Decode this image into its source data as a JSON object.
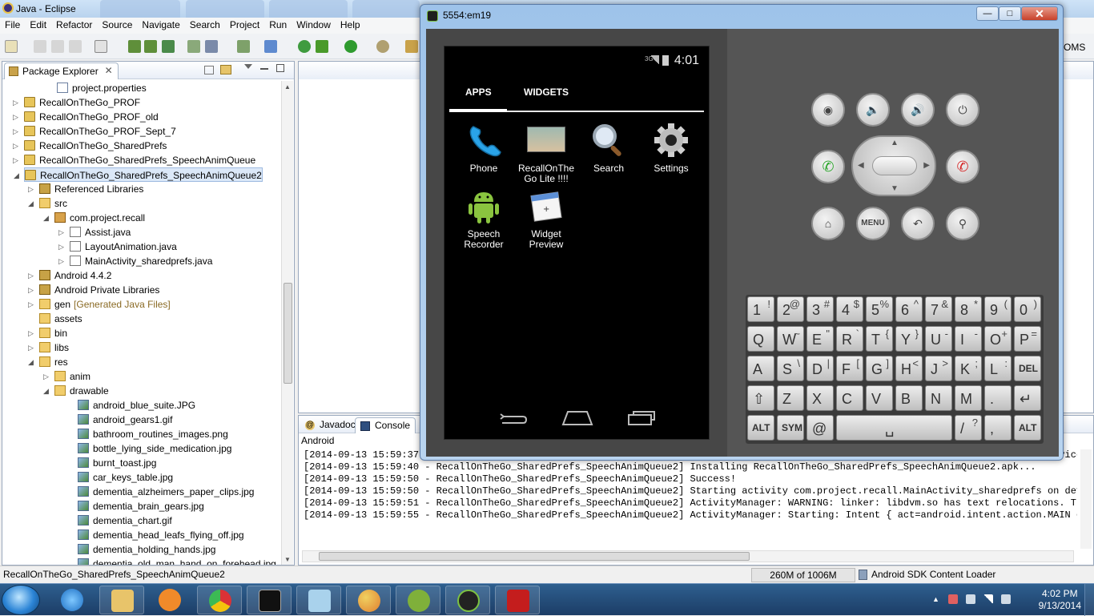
{
  "eclipse": {
    "title": "Java - Eclipse",
    "menu": [
      "File",
      "Edit",
      "Refactor",
      "Source",
      "Navigate",
      "Search",
      "Project",
      "Run",
      "Window",
      "Help"
    ],
    "oms_label": "OMS"
  },
  "package_explorer": {
    "tab_label": "Package Explorer",
    "close_glyph": "✕",
    "tree": [
      {
        "label": "project.properties",
        "icon": "file-icon",
        "expand": ""
      },
      {
        "label": "RecallOnTheGo_PROF",
        "icon": "project-icon",
        "expand": "▷"
      },
      {
        "label": "RecallOnTheGo_PROF_old",
        "icon": "project-icon",
        "expand": "▷"
      },
      {
        "label": "RecallOnTheGo_PROF_Sept_7",
        "icon": "project-icon",
        "expand": "▷"
      },
      {
        "label": "RecallOnTheGo_SharedPrefs",
        "icon": "project-icon",
        "expand": "▷"
      },
      {
        "label": "RecallOnTheGo_SharedPrefs_SpeechAnimQueue",
        "icon": "project-icon",
        "expand": "▷"
      },
      {
        "label": "RecallOnTheGo_SharedPrefs_SpeechAnimQueue2",
        "icon": "project-icon",
        "expand": "◢"
      },
      {
        "label": "Referenced Libraries",
        "icon": "library-icon",
        "expand": "▷"
      },
      {
        "label": "src",
        "icon": "source-folder-icon",
        "expand": "◢"
      },
      {
        "label": "com.project.recall",
        "icon": "package-icon",
        "expand": "◢"
      },
      {
        "label": "Assist.java",
        "icon": "java-file-icon",
        "expand": "▷"
      },
      {
        "label": "LayoutAnimation.java",
        "icon": "java-file-icon",
        "expand": "▷"
      },
      {
        "label": "MainActivity_sharedprefs.java",
        "icon": "java-file-icon",
        "expand": "▷"
      },
      {
        "label": "Android 4.4.2",
        "icon": "library-icon",
        "expand": "▷"
      },
      {
        "label": "Android Private Libraries",
        "icon": "library-icon",
        "expand": "▷"
      },
      {
        "label": "gen",
        "icon": "folder-icon",
        "expand": "▷",
        "suffix": "[Generated Java Files]"
      },
      {
        "label": "assets",
        "icon": "folder-icon",
        "expand": ""
      },
      {
        "label": "bin",
        "icon": "folder-icon",
        "expand": "▷"
      },
      {
        "label": "libs",
        "icon": "folder-icon",
        "expand": "▷"
      },
      {
        "label": "res",
        "icon": "folder-icon",
        "expand": "◢"
      },
      {
        "label": "anim",
        "icon": "folder-icon",
        "expand": "▷"
      },
      {
        "label": "drawable",
        "icon": "folder-icon",
        "expand": "◢"
      },
      {
        "label": "android_blue_suite.JPG",
        "icon": "image-file-icon",
        "expand": ""
      },
      {
        "label": "android_gears1.gif",
        "icon": "image-file-icon",
        "expand": ""
      },
      {
        "label": "bathroom_routines_images.png",
        "icon": "image-file-icon",
        "expand": ""
      },
      {
        "label": "bottle_lying_side_medication.jpg",
        "icon": "image-file-icon",
        "expand": ""
      },
      {
        "label": "burnt_toast.jpg",
        "icon": "image-file-icon",
        "expand": ""
      },
      {
        "label": "car_keys_table.jpg",
        "icon": "image-file-icon",
        "expand": ""
      },
      {
        "label": "dementia_alzheimers_paper_clips.jpg",
        "icon": "image-file-icon",
        "expand": ""
      },
      {
        "label": "dementia_brain_gears.jpg",
        "icon": "image-file-icon",
        "expand": ""
      },
      {
        "label": "dementia_chart.gif",
        "icon": "image-file-icon",
        "expand": ""
      },
      {
        "label": "dementia_head_leafs_flying_off.jpg",
        "icon": "image-file-icon",
        "expand": ""
      },
      {
        "label": "dementia_holding_hands.jpg",
        "icon": "image-file-icon",
        "expand": ""
      },
      {
        "label": "dementia_old_man_hand_on_forehead.jpg",
        "icon": "image-file-icon",
        "expand": ""
      }
    ]
  },
  "console": {
    "tabs": [
      "Javadoc",
      "Console"
    ],
    "subtitle": "Android",
    "lines": [
      "[2014-09-13 15:59:37 - RecallOnTheGo_SharedPrefs_SpeechAnimQueue2] Uploading RecallOnTheGo_SharedPrefs_SpeechAnimQueue2.apk onto device 'em",
      "[2014-09-13 15:59:40 - RecallOnTheGo_SharedPrefs_SpeechAnimQueue2] Installing RecallOnTheGo_SharedPrefs_SpeechAnimQueue2.apk...",
      "[2014-09-13 15:59:50 - RecallOnTheGo_SharedPrefs_SpeechAnimQueue2] Success!",
      "[2014-09-13 15:59:50 - RecallOnTheGo_SharedPrefs_SpeechAnimQueue2] Starting activity com.project.recall.MainActivity_sharedprefs on device",
      "[2014-09-13 15:59:51 - RecallOnTheGo_SharedPrefs_SpeechAnimQueue2] ActivityManager: WARNING: linker: libdvm.so has text relocations. This i",
      "[2014-09-13 15:59:55 - RecallOnTheGo_SharedPrefs_SpeechAnimQueue2] ActivityManager: Starting: Intent { act=android.intent.action.MAIN cat=["
    ]
  },
  "status": {
    "selected": "RecallOnTheGo_SharedPrefs_SpeechAnimQueue2",
    "memory": "260M of 1006M",
    "loader": "Android SDK Content Loader"
  },
  "emulator": {
    "title": "5554:em19",
    "minimize": "—",
    "maximize": "□",
    "close": "✕",
    "phone": {
      "time": "4:01",
      "signal": "3G",
      "tabs": [
        "APPS",
        "WIDGETS"
      ],
      "apps": [
        {
          "label": "Phone",
          "icon": "phone-icon"
        },
        {
          "label": "RecallOnThe Go Lite !!!!",
          "icon": "recall-app-icon"
        },
        {
          "label": "Search",
          "icon": "search-icon"
        },
        {
          "label": "Settings",
          "icon": "settings-gear-icon"
        },
        {
          "label": "Speech Recorder",
          "icon": "android-robot-icon"
        },
        {
          "label": "Widget Preview",
          "icon": "widget-preview-icon"
        }
      ]
    },
    "hw_buttons": {
      "menu": "MENU"
    },
    "keyboard": {
      "row1": [
        [
          "1",
          "!"
        ],
        [
          "2",
          "@"
        ],
        [
          "3",
          "#"
        ],
        [
          "4",
          "$"
        ],
        [
          "5",
          "%"
        ],
        [
          "6",
          "^"
        ],
        [
          "7",
          "&"
        ],
        [
          "8",
          "*"
        ],
        [
          "9",
          "("
        ],
        [
          "0",
          ")"
        ]
      ],
      "row2": [
        [
          "Q",
          ""
        ],
        [
          "W",
          "~"
        ],
        [
          "E",
          "\""
        ],
        [
          "R",
          "`"
        ],
        [
          "T",
          "{"
        ],
        [
          "Y",
          "}"
        ],
        [
          "U",
          "-"
        ],
        [
          "I",
          "-"
        ],
        [
          "O",
          "+"
        ],
        [
          "P",
          "="
        ]
      ],
      "row3": [
        [
          "A",
          ""
        ],
        [
          "S",
          "\\"
        ],
        [
          "D",
          "|"
        ],
        [
          "F",
          "["
        ],
        [
          "G",
          "]"
        ],
        [
          "H",
          "<"
        ],
        [
          "J",
          ">"
        ],
        [
          "K",
          ";"
        ],
        [
          "L",
          ":"
        ],
        [
          "DEL",
          ""
        ]
      ],
      "row4": [
        [
          "⇧",
          ""
        ],
        [
          "Z",
          ""
        ],
        [
          "X",
          ""
        ],
        [
          "C",
          ""
        ],
        [
          "V",
          ""
        ],
        [
          "B",
          ""
        ],
        [
          "N",
          ""
        ],
        [
          "M",
          ""
        ],
        [
          ".",
          ""
        ],
        [
          "↵",
          ""
        ]
      ],
      "row5": {
        "alt_left": "ALT",
        "sym": "SYM",
        "at": "@",
        "space": "␣",
        "slash": "/",
        "slash_alt": "?",
        "comma": ",",
        "comma_alt": "",
        "alt_right": "ALT"
      }
    }
  },
  "taskbar": {
    "time": "4:02 PM",
    "date": "9/13/2014"
  }
}
